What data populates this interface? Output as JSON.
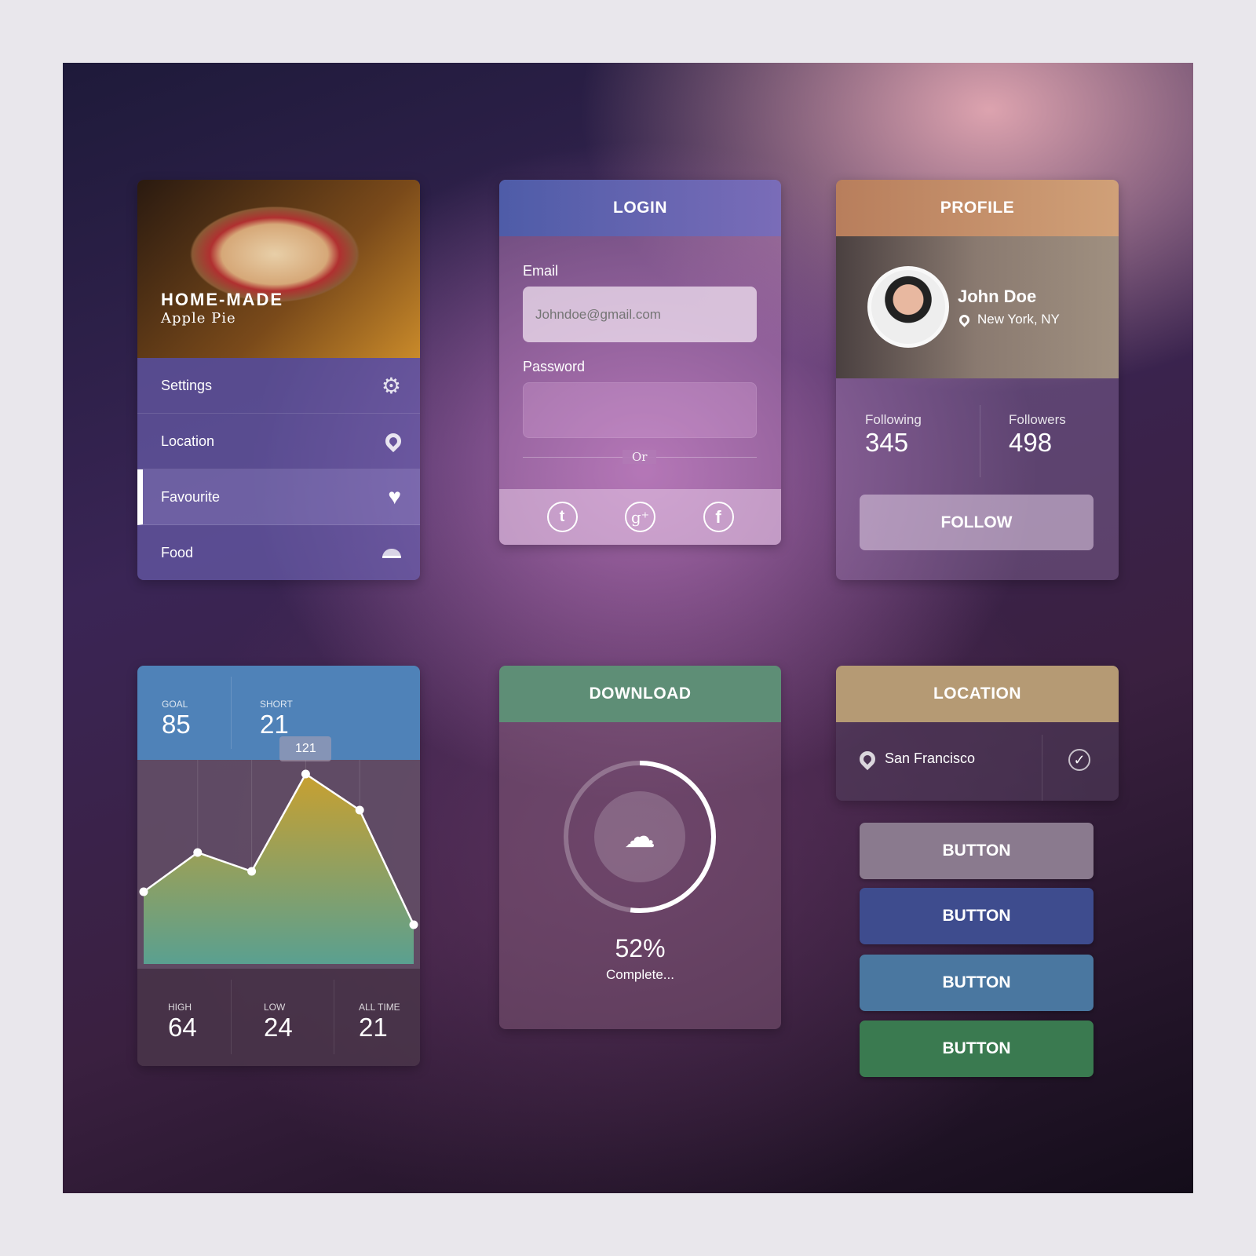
{
  "recipe": {
    "title": "HOME-MADE",
    "subtitle": "Apple Pie",
    "menu": [
      {
        "label": "Settings",
        "icon": "gear-icon"
      },
      {
        "label": "Location",
        "icon": "pin-icon"
      },
      {
        "label": "Favourite",
        "icon": "heart-icon",
        "active": true
      },
      {
        "label": "Food",
        "icon": "cloche-icon"
      }
    ]
  },
  "login": {
    "title": "LOGIN",
    "email_label": "Email",
    "email_placeholder": "Johndoe@gmail.com",
    "password_label": "Password",
    "or": "Or",
    "social": [
      "twitter-icon",
      "google-plus-icon",
      "facebook-icon"
    ]
  },
  "profile": {
    "title": "PROFILE",
    "name": "John Doe",
    "location": "New York, NY",
    "following_label": "Following",
    "following": "345",
    "followers_label": "Followers",
    "followers": "498",
    "follow": "FOLLOW"
  },
  "stats": {
    "goal_label": "GOAL",
    "goal": "85",
    "short_label": "SHORT",
    "short": "21",
    "high_label": "HIGH",
    "high": "64",
    "low_label": "LOW",
    "low": "24",
    "alltime_label": "ALL TIME",
    "alltime": "21",
    "tooltip": "121"
  },
  "chart_data": {
    "type": "area",
    "values": [
      46,
      71,
      59,
      121,
      98,
      25
    ],
    "highlight_index": 3,
    "ylim": [
      0,
      130
    ],
    "grid": "vertical"
  },
  "download": {
    "title": "DOWNLOAD",
    "percent_text": "52%",
    "progress": 0.52,
    "status": "Complete..."
  },
  "location": {
    "title": "LOCATION",
    "city": "San Francisco"
  },
  "buttons": [
    {
      "label": "BUTTON",
      "color": "#8a7a8e"
    },
    {
      "label": "BUTTON",
      "color": "#3e4c8e"
    },
    {
      "label": "BUTTON",
      "color": "#4a77a0"
    },
    {
      "label": "BUTTON",
      "color": "#3a7a50"
    }
  ],
  "colors": {
    "login": "#5a62b0",
    "profile": "#c08a68",
    "download": "#5e8e76",
    "location": "#b59a74",
    "stats": "#4f82b8"
  }
}
